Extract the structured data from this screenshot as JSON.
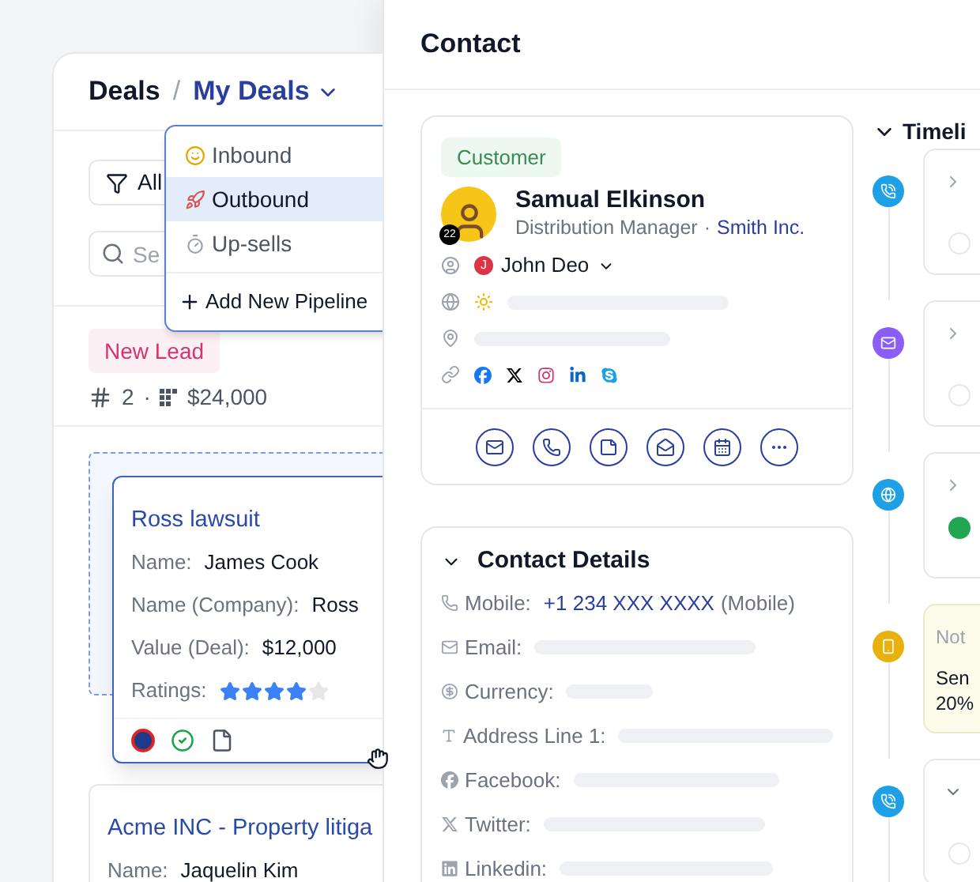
{
  "deals": {
    "title": "Deals",
    "separator": "/",
    "breadcrumb": "My Deals",
    "filter": {
      "label": "All"
    },
    "search": {
      "placeholder": "Se"
    },
    "pipeline_menu": {
      "items": [
        {
          "label": "Inbound",
          "selected": false
        },
        {
          "label": "Outbound",
          "selected": true
        },
        {
          "label": "Up-sells",
          "selected": false
        }
      ],
      "add_label": "Add New Pipeline"
    },
    "stage": {
      "label": "New Lead",
      "count": "2",
      "separator": "·",
      "value": "$24,000"
    },
    "cards": [
      {
        "title": "Ross lawsuit",
        "dragging": true,
        "fields": [
          {
            "label": "Name:",
            "value": "James Cook"
          },
          {
            "label": "Name (Company):",
            "value": "Ross"
          },
          {
            "label": "Value (Deal):",
            "value": "$12,000"
          }
        ],
        "ratings_label": "Ratings:",
        "stars": 4
      },
      {
        "title": "Acme INC - Property litiga",
        "dragging": false,
        "fields": [
          {
            "label": "Name:",
            "value": "Jaquelin Kim"
          }
        ]
      }
    ]
  },
  "contact": {
    "title": "Contact",
    "badge": "Customer",
    "name": "Samual Elkinson",
    "role": "Distribution Manager",
    "separator": "·",
    "company": "Smith Inc.",
    "avatar_badge": "22",
    "owner": {
      "initial": "J",
      "name": "John Deo"
    }
  },
  "details": {
    "title": "Contact Details",
    "expanded": true,
    "rows": [
      {
        "label": "Mobile:",
        "value": "+1 234 XXX XXXX",
        "suffix": "(Mobile)"
      },
      {
        "label": "Email:"
      },
      {
        "label": "Currency:"
      },
      {
        "label": "Address Line 1:"
      },
      {
        "label": "Facebook:"
      },
      {
        "label": "Twitter:"
      },
      {
        "label": "Linkedin:"
      }
    ]
  },
  "timeline": {
    "title": "Timeli",
    "expanded": true,
    "items": [
      {
        "kind": "call",
        "color": "#1ea0e6",
        "expanded": false
      },
      {
        "kind": "email",
        "color": "#8b5cf6",
        "expanded": false
      },
      {
        "kind": "web",
        "color": "#1ea0e6",
        "expanded": false
      },
      {
        "kind": "note",
        "color": "#e8b10e",
        "label": "Not",
        "lines": [
          "Sen",
          "20%"
        ]
      },
      {
        "kind": "call",
        "color": "#1ea0e6",
        "expanded": true
      }
    ]
  }
}
